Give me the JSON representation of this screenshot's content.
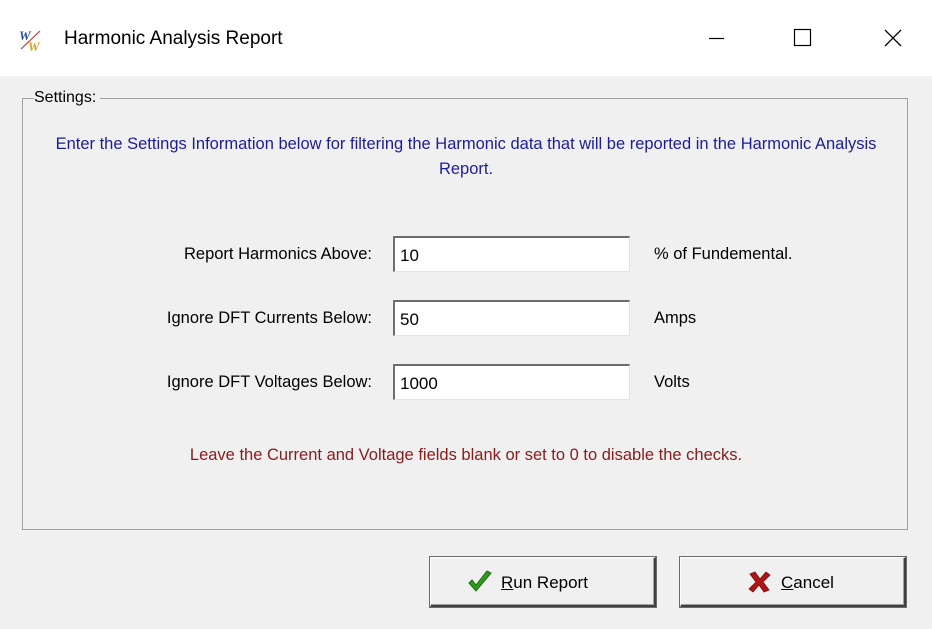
{
  "window": {
    "title": "Harmonic Analysis Report",
    "icon": "ww-app-icon",
    "controls": [
      "minimize-icon",
      "maximize-icon",
      "close-icon"
    ]
  },
  "settings": {
    "group_label": "Settings:",
    "instruction": "Enter the Settings Information below for filtering the Harmonic data that will be reported in the Harmonic Analysis Report.",
    "fields": [
      {
        "label": "Report Harmonics Above:",
        "value": "10",
        "unit": "% of Fundemental."
      },
      {
        "label": "Ignore DFT Currents Below:",
        "value": "50",
        "unit": "Amps"
      },
      {
        "label": "Ignore DFT Voltages Below:",
        "value": "1000",
        "unit": "Volts"
      }
    ],
    "note": "Leave the Current and Voltage fields blank or set to 0 to disable the checks."
  },
  "buttons": {
    "run": {
      "accel": "R",
      "rest": "un Report",
      "icon": "checkmark-icon",
      "icon_color": "#2e9b1e"
    },
    "cancel": {
      "accel": "C",
      "rest": "ancel",
      "icon": "x-mark-icon",
      "icon_color": "#b01515"
    }
  },
  "colors": {
    "instruction_text": "#1c1c9e",
    "note_text": "#8b1a1a",
    "background": "#f0f0f0"
  }
}
